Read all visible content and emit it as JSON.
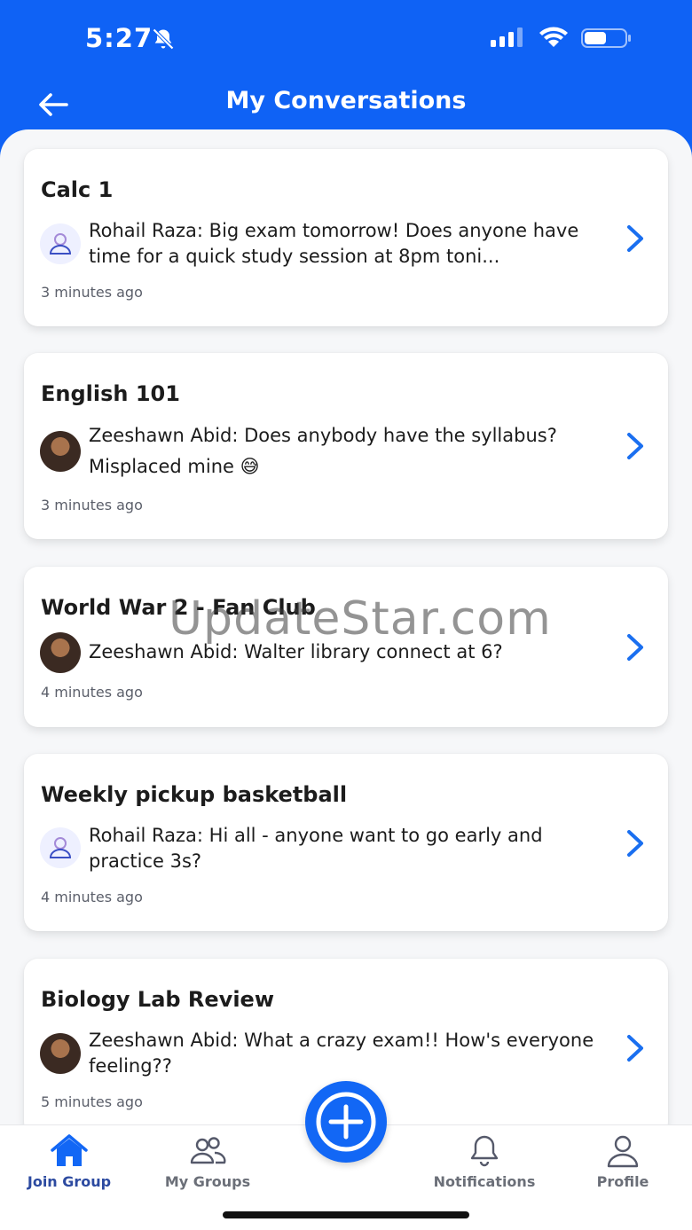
{
  "status": {
    "time": "5:27"
  },
  "header": {
    "title": "My Conversations",
    "back_icon": "arrow-left-icon"
  },
  "conversations": [
    {
      "title": "Calc 1",
      "avatar": "generic-user",
      "message": "Rohail Raza: Big exam tomorrow! Does anyone have time for a quick study session at 8pm toni...",
      "time": "3 minutes ago"
    },
    {
      "title": "English 101",
      "avatar": "photo",
      "message": "Zeeshawn Abid: Does anybody have the syllabus? Misplaced mine 😅",
      "time": "3 minutes ago"
    },
    {
      "title": "World War 2 - Fan Club",
      "avatar": "photo",
      "message": "Zeeshawn Abid: Walter library connect at 6?",
      "time": "4 minutes ago"
    },
    {
      "title": "Weekly pickup basketball",
      "avatar": "generic-user",
      "message": "Rohail Raza: Hi all - anyone want to go early and practice 3s?",
      "time": "4 minutes ago"
    },
    {
      "title": "Biology Lab Review",
      "avatar": "photo",
      "message": "Zeeshawn Abid: What a crazy exam!! How's everyone feeling??",
      "time": "5 minutes ago"
    }
  ],
  "tabs": [
    {
      "label": "Join Group",
      "icon": "home-icon",
      "active": true
    },
    {
      "label": "My Groups",
      "icon": "users-icon",
      "active": false
    },
    {
      "label": "Notifications",
      "icon": "bell-icon",
      "active": false
    },
    {
      "label": "Profile",
      "icon": "user-icon",
      "active": false
    }
  ],
  "watermark": "UpdateStar.com",
  "colors": {
    "primary": "#0f62f5",
    "chevron": "#1a6ff0",
    "tab_active": "#2c4aa0"
  }
}
